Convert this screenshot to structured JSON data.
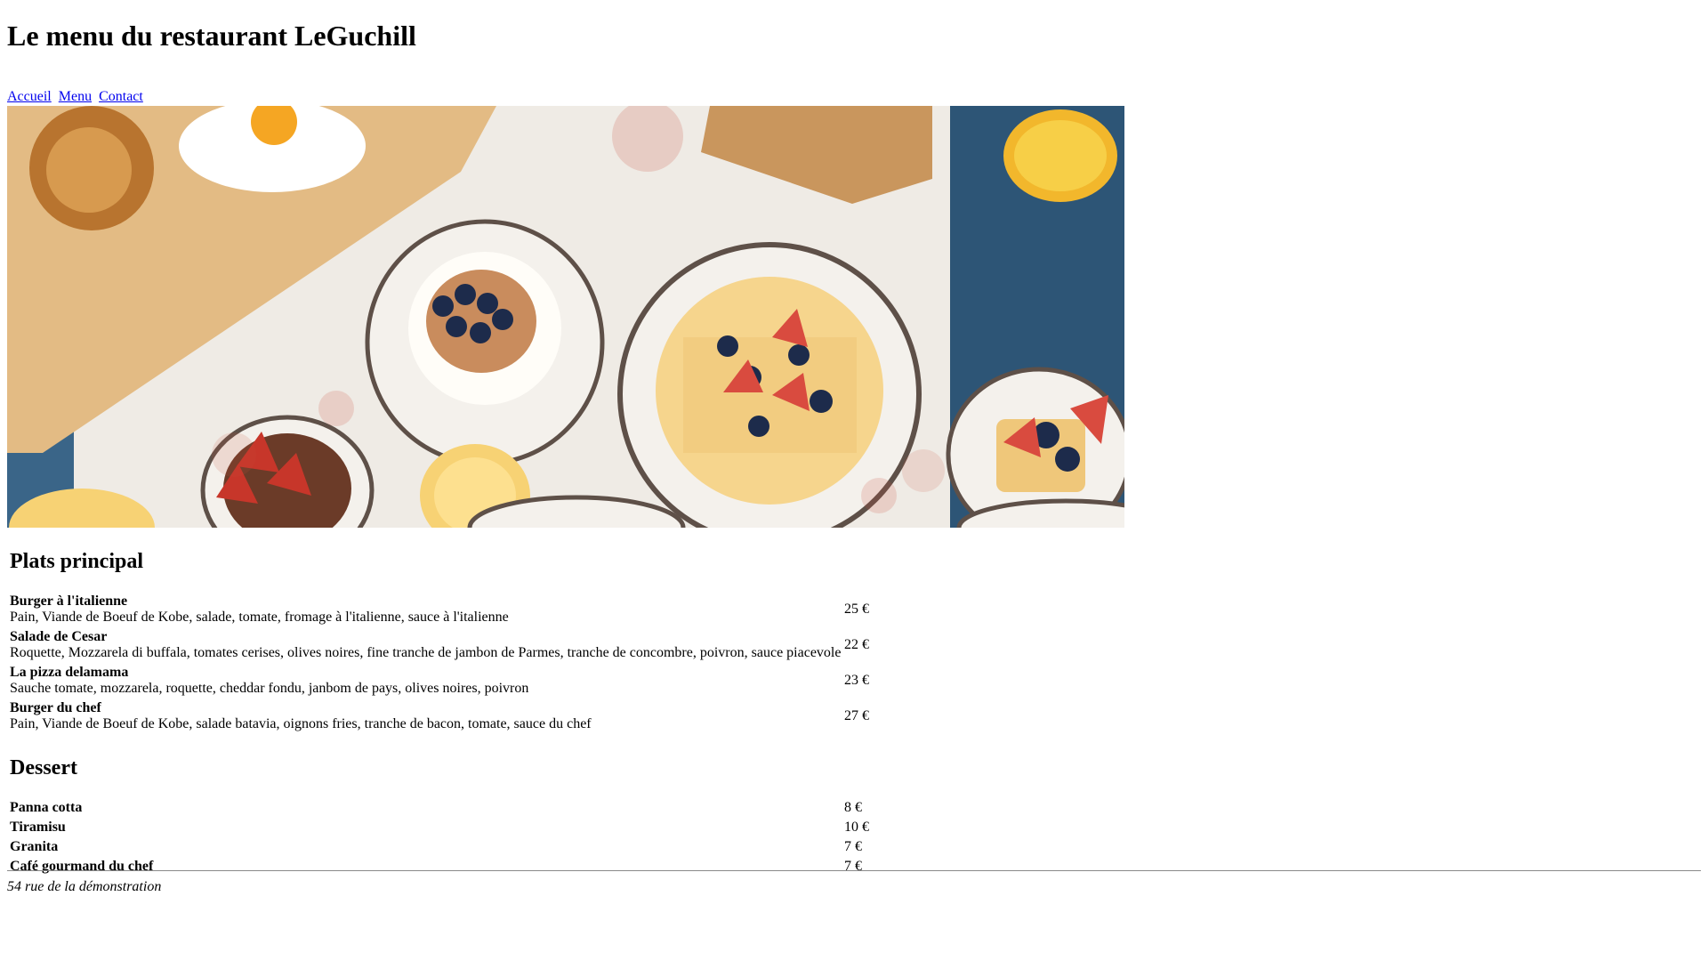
{
  "page": {
    "title": "Le menu du restaurant LeGuchill",
    "nav": [
      "Accueil",
      "Menu",
      "Contact"
    ],
    "hero_alt": "Breakfast table with waffles, pancakes, strawberries and orange juice"
  },
  "main_courses": {
    "title": "Plats principal",
    "items": [
      {
        "name": "Burger à l'italienne",
        "description": "Pain, Viande de Boeuf de Kobe, salade, tomate, fromage à l'italienne, sauce à l'italienne",
        "price": "25 €"
      },
      {
        "name": "Salade de Cesar",
        "description": "Roquette, Mozzarela di buffala, tomates cerises, olives noires, fine tranche de jambon de Parmes, tranche de concombre, poivron, sauce piacevole",
        "price": "22 €"
      },
      {
        "name": "La pizza delamama",
        "description": "Sauche tomate, mozzarela, roquette, cheddar fondu, janbom de pays, olives noires, poivron",
        "price": "23 €"
      },
      {
        "name": "Burger du chef",
        "description": "Pain, Viande de Boeuf de Kobe, salade batavia, oignons fries, tranche de bacon, tomate, sauce du chef",
        "price": "27 €"
      }
    ]
  },
  "desserts": {
    "title": "Dessert",
    "items": [
      {
        "name": "Panna cotta",
        "price": "8 €"
      },
      {
        "name": "Tiramisu",
        "price": "10 €"
      },
      {
        "name": "Granita",
        "price": "7 €"
      },
      {
        "name": "Café gourmand du chef",
        "price": "7 €"
      }
    ]
  },
  "footer": {
    "address": "54 rue de la démonstration"
  },
  "colors": {
    "link": "#0000ee",
    "rule": "#8a8a8a"
  }
}
